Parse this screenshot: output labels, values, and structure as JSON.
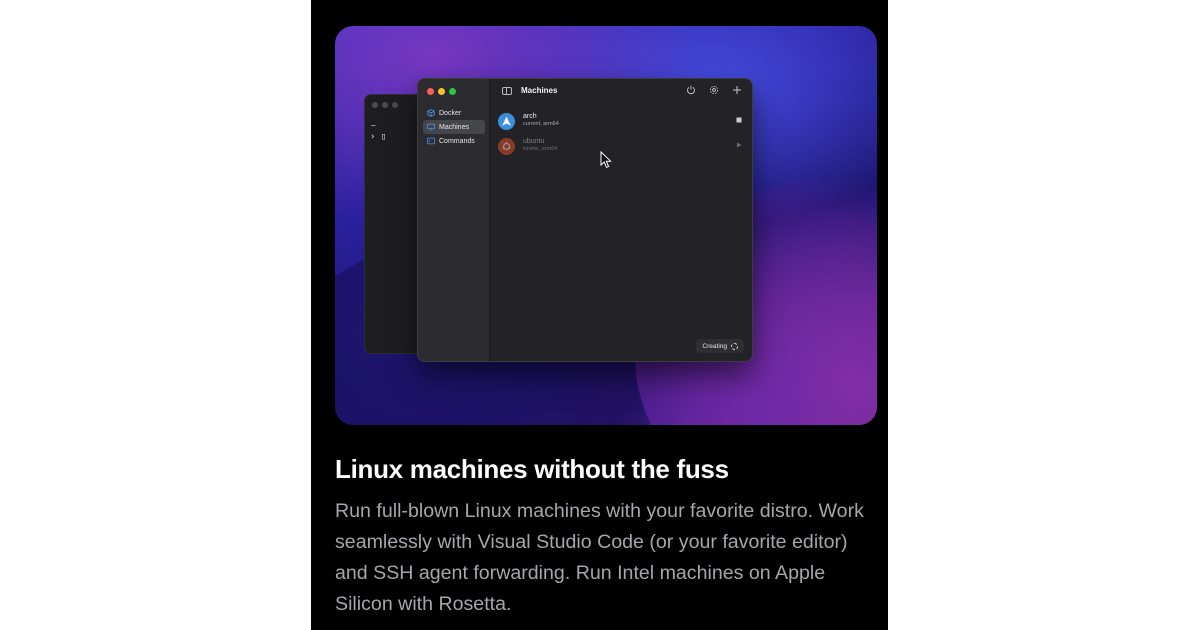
{
  "window": {
    "title": "Machines"
  },
  "sidebar": {
    "items": [
      {
        "label": "Docker",
        "icon": "cube-icon",
        "active": false
      },
      {
        "label": "Machines",
        "icon": "display-icon",
        "active": true
      },
      {
        "label": "Commands",
        "icon": "terminal-icon",
        "active": false
      }
    ]
  },
  "toolbar": {
    "icons": [
      "power-icon",
      "gear-icon",
      "plus-icon"
    ]
  },
  "machines": [
    {
      "name": "arch",
      "detail": "current, arm64",
      "action_icon": "stop-icon",
      "color": "#3b8fd9"
    },
    {
      "name": "ubuntu",
      "detail": "kinetic, arm64",
      "action_icon": "play-icon",
      "color": "#d9512c"
    }
  ],
  "terminal": {
    "tilde": "~",
    "prompt": "› ▯"
  },
  "status": {
    "label": "Creating"
  },
  "feature": {
    "heading": "Linux machines without the fuss",
    "body": "Run full-blown Linux machines with your favorite distro. Work seamlessly with Visual Studio Code (or your favorite editor) and SSH agent forwarding. Run Intel machines on Apple Silicon with Rosetta."
  },
  "colors": {
    "page_background": "#000000",
    "window_background": "#232327",
    "heading": "#ffffff",
    "body_text": "#a6a6ab"
  }
}
